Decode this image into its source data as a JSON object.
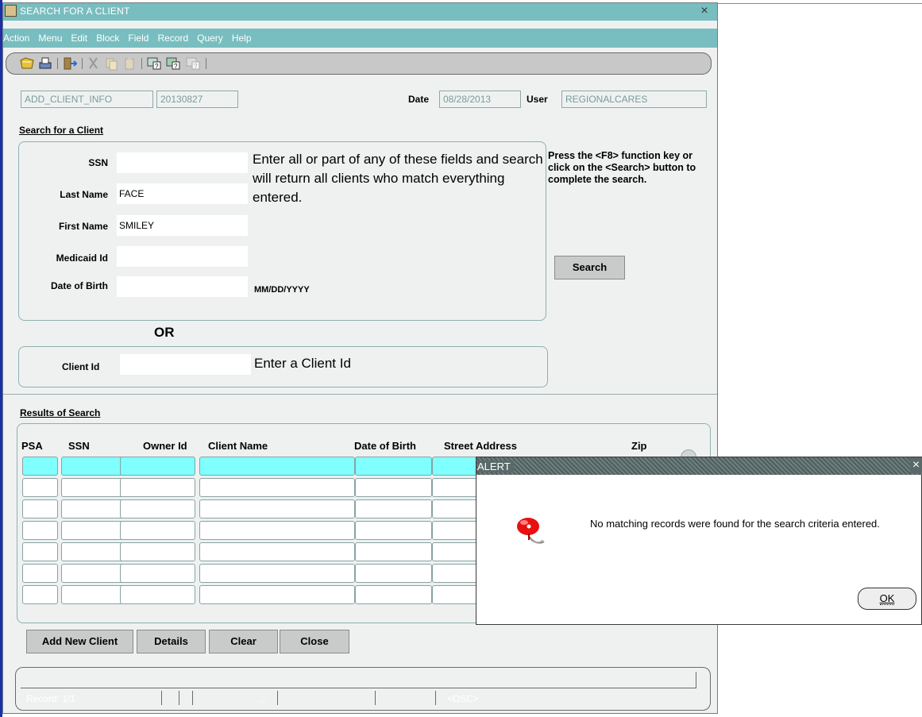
{
  "window": {
    "title": "SEARCH FOR A CLIENT",
    "close_glyph": "×"
  },
  "menu": [
    "Action",
    "Menu",
    "Edit",
    "Block",
    "Field",
    "Record",
    "Query",
    "Help"
  ],
  "toolbar_icons": [
    "save-icon",
    "print-icon",
    "exit-icon",
    "cut-icon",
    "copy-icon",
    "paste-icon",
    "enter-query-icon",
    "execute-query-icon",
    "cancel-query-icon"
  ],
  "header": {
    "form_name": "ADD_CLIENT_INFO",
    "form_version": "20130827",
    "date_label": "Date",
    "date_value": "08/28/2013",
    "user_label": "User",
    "user_value": "REGIONALCARES"
  },
  "search": {
    "section_title": "Search for a Client",
    "fields": [
      {
        "label": "SSN",
        "value": ""
      },
      {
        "label": "Last Name",
        "value": "FACE"
      },
      {
        "label": "First Name",
        "value": "SMILEY"
      },
      {
        "label": "Medicaid Id",
        "value": ""
      },
      {
        "label": "Date of Birth",
        "value": ""
      }
    ],
    "instructions": "Enter all or part of any of these fields and search will return all clients who match everything entered.",
    "dob_format": "MM/DD/YYYY",
    "help_text": "Press the <F8> function key or click on the <Search> button to complete the search.",
    "search_button": "Search",
    "or_label": "OR",
    "client_id_label": "Client Id",
    "client_id_value": "",
    "client_id_hint": "Enter a Client Id"
  },
  "results": {
    "section_title": "Results of Search",
    "columns": [
      "PSA",
      "SSN",
      "Owner Id",
      "Client Name",
      "Date of Birth",
      "Street Address",
      "Zip"
    ],
    "rows": 7
  },
  "buttons": {
    "add_new_client": "Add New Client",
    "details": "Details",
    "clear": "Clear",
    "close": "Close"
  },
  "status": {
    "record": "Record: 1/1",
    "ellipsis": "...",
    "osc": "<OSC>"
  },
  "alert": {
    "title": "ALERT",
    "close_glyph": "×",
    "message": "No matching records were found for the search criteria entered.",
    "ok": "OK",
    "icon": "alarm-bell-icon"
  }
}
